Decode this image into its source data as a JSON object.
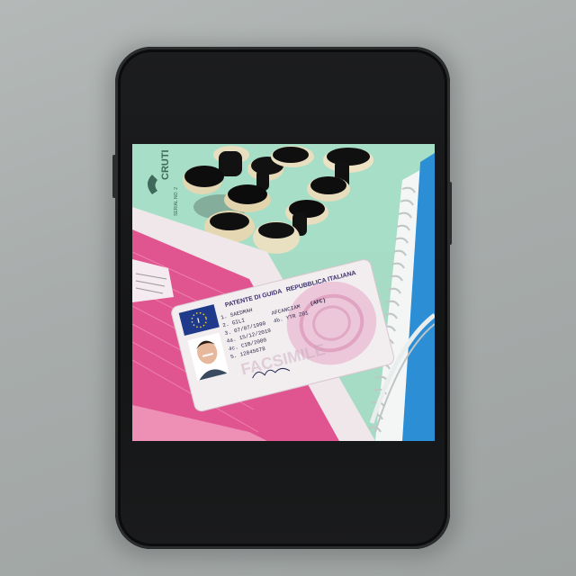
{
  "photo": {
    "stamp_text": "CRUTI",
    "stamp_small": "SERIAL NO. 2"
  },
  "license": {
    "header_left": "PATENTE DI GUIDA",
    "header_right": "REPUBBLICA ITALIANA",
    "country_code": "I",
    "badge": "(AFC)",
    "fields": [
      {
        "num": "1.",
        "text": "SAEDMAH"
      },
      {
        "num": "2.",
        "text": "GILI"
      },
      {
        "num": "3.",
        "text": "07/07/1990"
      },
      {
        "num": "4a.",
        "text": "15/12/2019"
      },
      {
        "num": "4c.",
        "text": "CIB/2000"
      },
      {
        "num": "5.",
        "text": "12845678"
      }
    ],
    "right_fields": [
      {
        "num": "",
        "text": "AFCANCIAM"
      },
      {
        "num": "4b.",
        "text": "YTR Z01"
      }
    ],
    "watermark": "FACSIMILE",
    "colors": {
      "card": "#f2eef0",
      "pink": "#e6a7c6",
      "flag_blue": "#1f3a8a",
      "flag_star": "#f2d33a"
    }
  },
  "colors": {
    "background": "#a8adac",
    "phone_body": "#161718",
    "mat_green": "#a5dcc4",
    "pink_doc": "#e0558f",
    "notebook_blue": "#2c8fd6"
  }
}
